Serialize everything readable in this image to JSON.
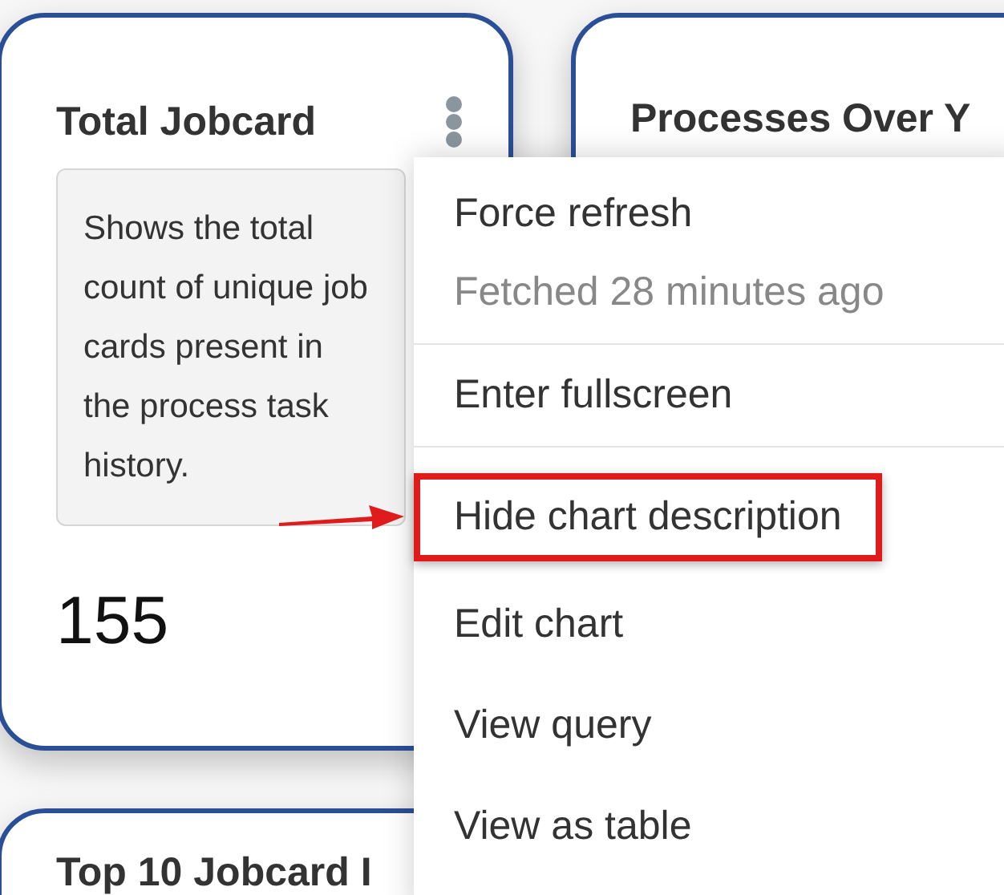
{
  "cards": [
    {
      "title": "Total Jobcard",
      "description": "Shows the total count of unique job cards present in the process task history.",
      "value": "155"
    },
    {
      "title": "Processes Over Y"
    },
    {
      "title": "Top 10 Jobcard I"
    }
  ],
  "menu": {
    "items": [
      {
        "kind": "action",
        "label": "Force refresh",
        "highlighted": false
      },
      {
        "kind": "note",
        "label": "Fetched 28 minutes ago",
        "highlighted": false
      },
      {
        "kind": "divider"
      },
      {
        "kind": "action",
        "label": "Enter fullscreen",
        "highlighted": false
      },
      {
        "kind": "divider"
      },
      {
        "kind": "action",
        "label": "Hide chart description",
        "highlighted": true
      },
      {
        "kind": "action",
        "label": "Edit chart",
        "highlighted": false
      },
      {
        "kind": "action",
        "label": "View query",
        "highlighted": false
      },
      {
        "kind": "action",
        "label": "View as table",
        "highlighted": false
      }
    ]
  }
}
